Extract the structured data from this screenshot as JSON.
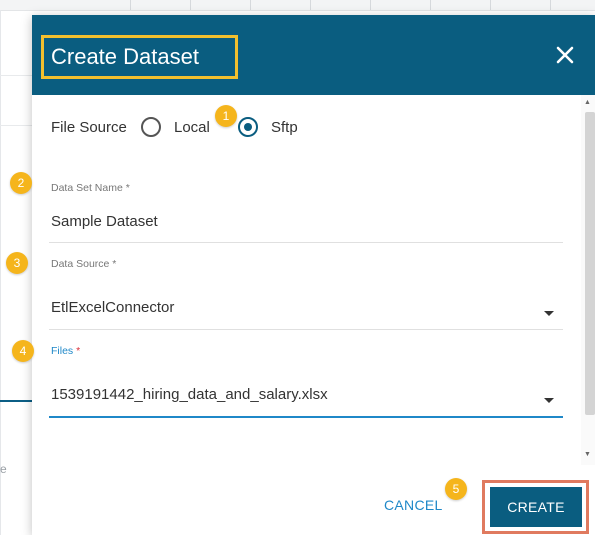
{
  "dialog": {
    "title": "Create Dataset",
    "close_icon": "close-icon"
  },
  "file_source": {
    "label": "File Source",
    "options": [
      {
        "label": "Local",
        "selected": false
      },
      {
        "label": "Sftp",
        "selected": true
      }
    ]
  },
  "fields": {
    "dataset_name": {
      "label": "Data Set Name *",
      "value": "Sample Dataset"
    },
    "data_source": {
      "label": "Data Source *",
      "value": "EtlExcelConnector"
    },
    "files": {
      "label": "Files",
      "required_mark": "*",
      "value": "1539191442_hiring_data_and_salary.xlsx"
    }
  },
  "badges": [
    "1",
    "2",
    "3",
    "4",
    "5"
  ],
  "footer": {
    "cancel_label": "CANCEL",
    "create_label": "CREATE"
  },
  "background": {
    "partial_char": "e"
  },
  "colors": {
    "header": "#0a5d80",
    "highlight_yellow": "#f3c02e",
    "highlight_orange": "#e07a5f",
    "badge": "#f5b51c",
    "active_blue": "#1f88c8"
  }
}
